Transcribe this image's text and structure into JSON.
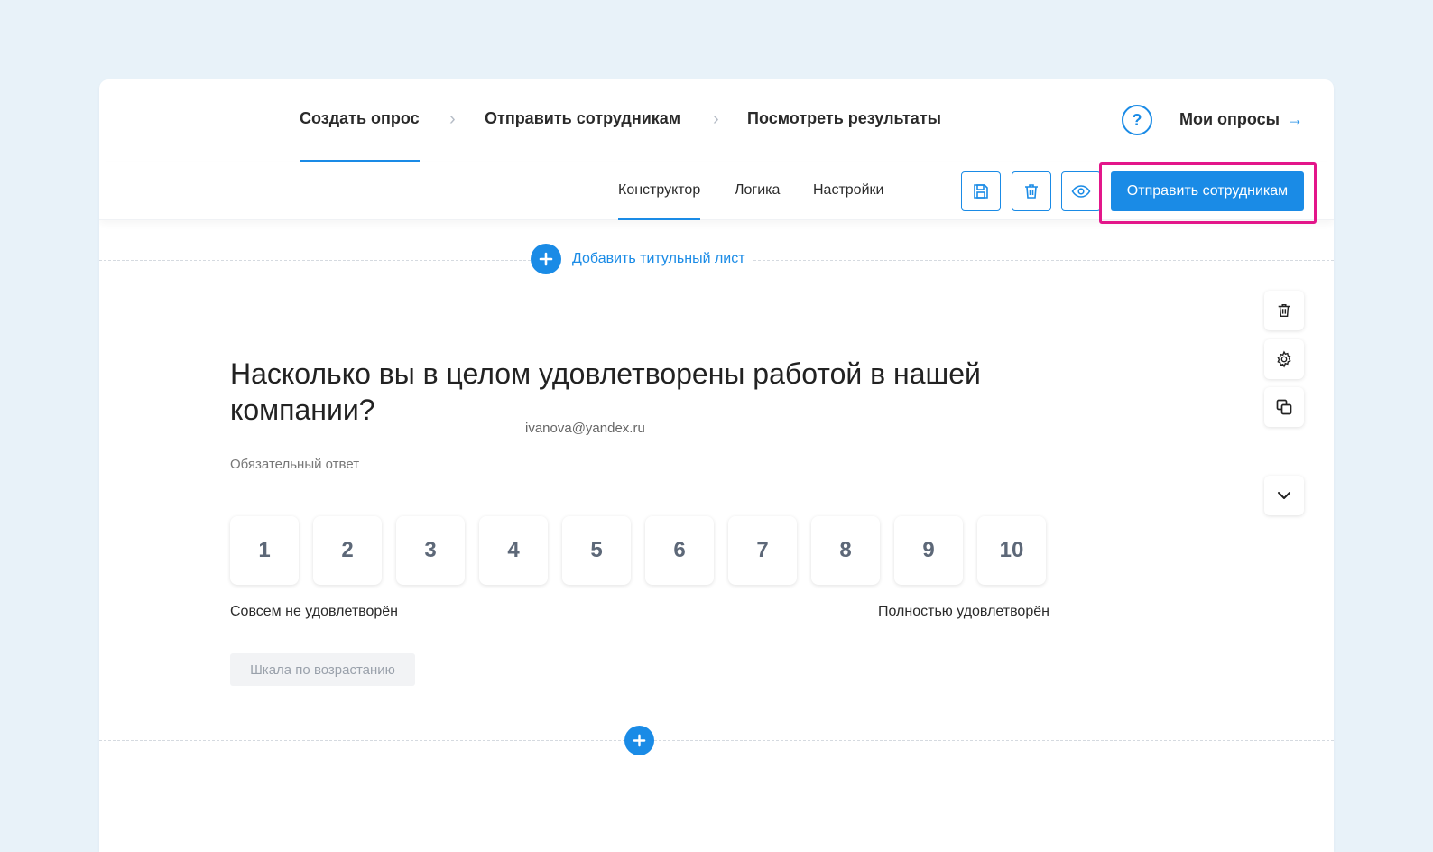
{
  "steps": [
    {
      "label": "Создать опрос",
      "active": true
    },
    {
      "label": "Отправить сотрудникам",
      "active": false
    },
    {
      "label": "Посмотреть результаты",
      "active": false
    }
  ],
  "step_separator": "›",
  "help": {
    "label": "?"
  },
  "my_surveys": {
    "label": "Мои опросы",
    "arrow": "→"
  },
  "subtabs": [
    {
      "label": "Конструктор",
      "active": true
    },
    {
      "label": "Логика",
      "active": false
    },
    {
      "label": "Настройки",
      "active": false
    }
  ],
  "toolbar": {
    "icons": [
      "save-icon",
      "trash-icon",
      "eye-icon"
    ],
    "send_label": "Отправить сотрудникам"
  },
  "add_title": {
    "label": "Добавить титульный лист"
  },
  "side_tools": [
    "trash-icon",
    "gear-icon",
    "copy-icon",
    "chevron-down-icon"
  ],
  "question": {
    "title": "Насколько вы в целом удовлетворены работой в нашей компании?",
    "email": "ivanova@yandex.ru",
    "required": "Обязательный ответ",
    "scale": [
      "1",
      "2",
      "3",
      "4",
      "5",
      "6",
      "7",
      "8",
      "9",
      "10"
    ],
    "min_label": "Совсем не удовлетворён",
    "max_label": "Полностью удовлетворён",
    "order": "Шкала по возрастанию"
  },
  "colors": {
    "accent": "#1a8be6",
    "highlight": "#e3168a",
    "background": "#e8f2f9"
  }
}
